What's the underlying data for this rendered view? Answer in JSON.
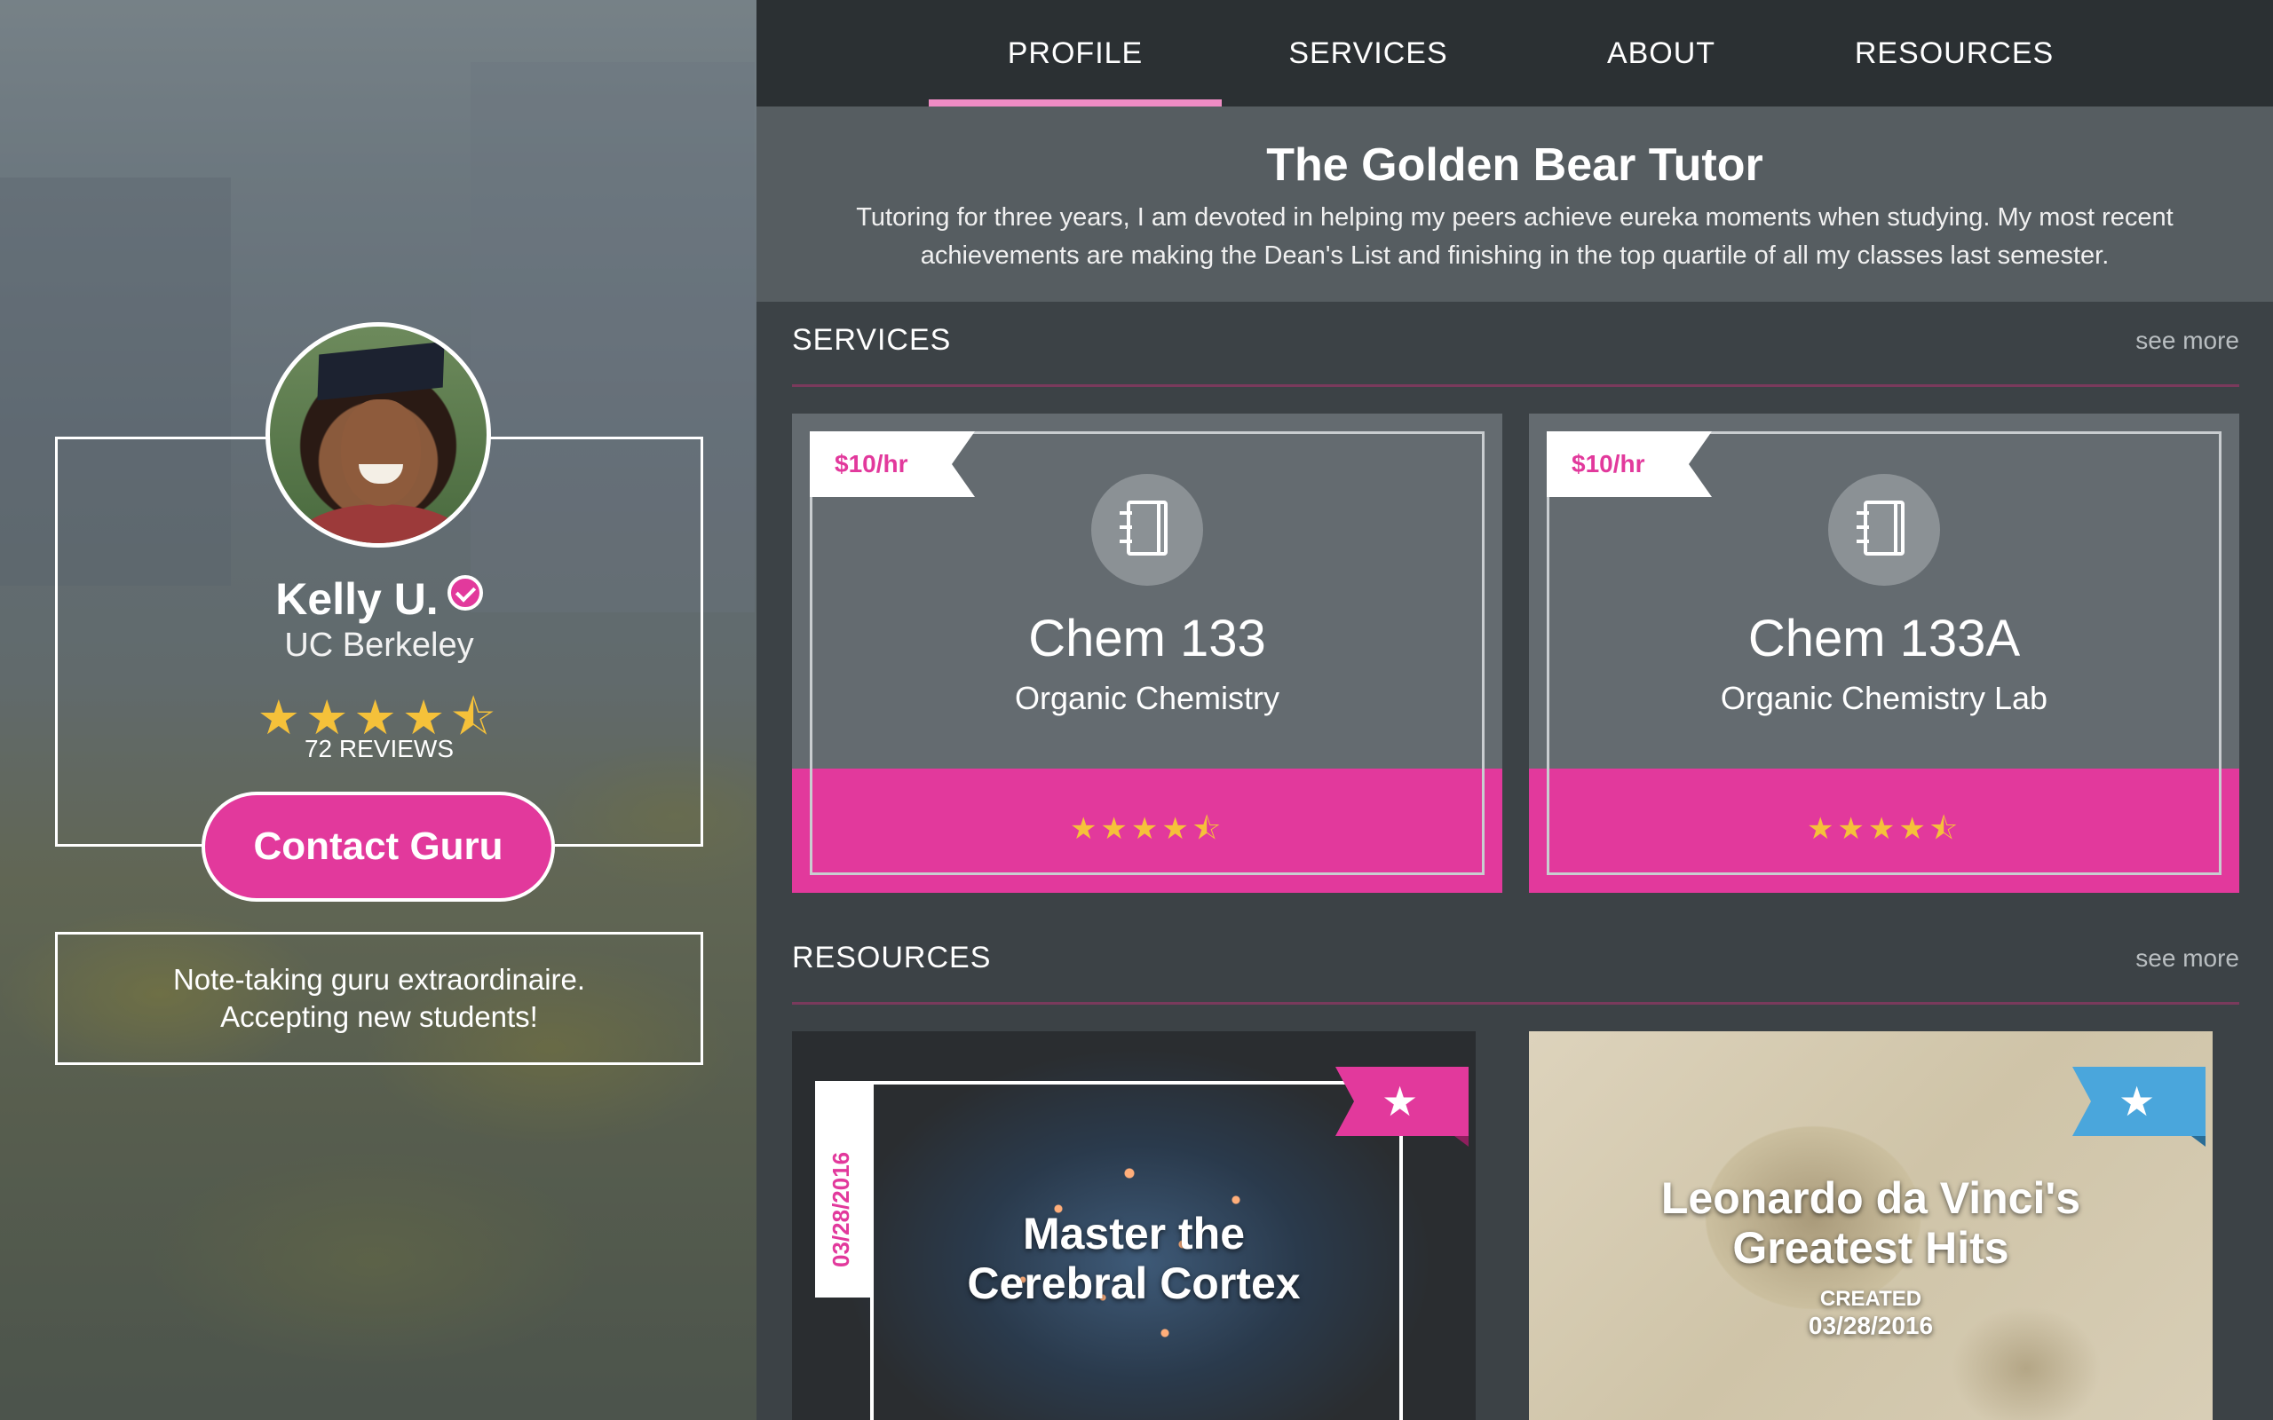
{
  "nav": {
    "items": [
      "PROFILE",
      "SERVICES",
      "ABOUT",
      "RESOURCES"
    ],
    "active": "PROFILE"
  },
  "profile": {
    "name": "Kelly U.",
    "school": "UC Berkeley",
    "rating_stars": 4.5,
    "reviews": "72 REVIEWS",
    "contact_label": "Contact Guru",
    "tagline_line1": "Note-taking guru extraordinaire.",
    "tagline_line2": "Accepting new students!"
  },
  "hero": {
    "title": "The Golden Bear Tutor",
    "description": "Tutoring for three years, I am devoted in helping my peers achieve eureka moments when studying. My most recent achievements are making the Dean's List and finishing in the top quartile of all my classes last semester."
  },
  "services": {
    "title": "SERVICES",
    "see_more": "see more",
    "cards": [
      {
        "price": "$10/hr",
        "code": "Chem 133",
        "subject": "Organic Chemistry",
        "rating_stars": 4.5
      },
      {
        "price": "$10/hr",
        "code": "Chem 133A",
        "subject": "Organic Chemistry Lab",
        "rating_stars": 4.5
      }
    ]
  },
  "resources": {
    "title": "RESOURCES",
    "see_more": "see more",
    "cards": [
      {
        "date": "03/28/2016",
        "title_line1": "Master the",
        "title_line2": "Cerebral Cortex",
        "ribbon_color": "#e2399c"
      },
      {
        "title_line1": "Leonardo da Vinci's",
        "title_line2": "Greatest Hits",
        "created_label": "CREATED",
        "date": "03/28/2016",
        "ribbon_color": "#4aa6dc"
      }
    ]
  },
  "colors": {
    "accent": "#e2399c",
    "star": "#f5c13a",
    "nav_active": "#ef8cc4",
    "ribbon_blue": "#4aa6dc"
  },
  "icons": {
    "star_full": "★",
    "star_half": "⯪",
    "service_icon": "notebook-icon"
  }
}
